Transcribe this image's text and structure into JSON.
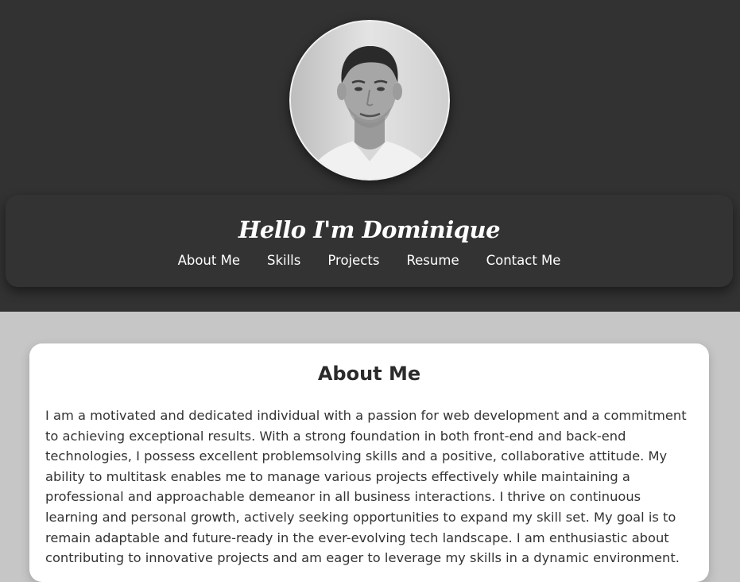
{
  "header": {
    "greeting": "Hello I'm Dominique",
    "avatar_alt": "Portrait photo of Dominique"
  },
  "nav": {
    "items": [
      {
        "label": "About Me"
      },
      {
        "label": "Skills"
      },
      {
        "label": "Projects"
      },
      {
        "label": "Resume"
      },
      {
        "label": "Contact Me"
      }
    ]
  },
  "about": {
    "title": "About Me",
    "body": "I am a motivated and dedicated individual with a passion for web development and a commitment to achieving exceptional results. With a strong foundation in both front-end and back-end technologies, I possess excellent problemsolving skills and a positive, collaborative attitude. My ability to multitask enables me to manage various projects effectively while maintaining a professional and approachable demeanor in all business interactions. I thrive on continuous learning and personal growth, actively seeking opportunities to expand my skill set. My goal is to remain adaptable and future-ready in the ever-evolving tech landscape. I am enthusiastic about contributing to innovative projects and am eager to leverage my skills in a dynamic environment."
  },
  "colors": {
    "header_bg": "#323232",
    "card_bg": "#333333",
    "page_bg": "#c6c6c6",
    "about_card_bg": "#ffffff",
    "text_dark": "#333333"
  }
}
